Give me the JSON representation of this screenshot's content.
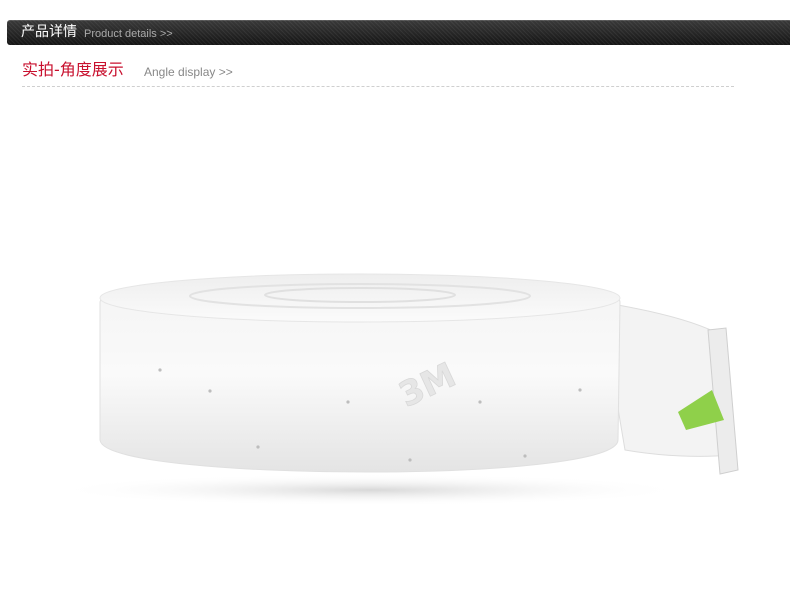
{
  "header": {
    "title_cn": "产品详情",
    "title_en": "Product details >>"
  },
  "section": {
    "title_cn": "实拍-角度展示",
    "title_en": "Angle display >>"
  },
  "photo": {
    "logo_text": "3M",
    "colors": {
      "tape_green": "#8fd04a",
      "roll_white": "#f7f7f7"
    }
  }
}
